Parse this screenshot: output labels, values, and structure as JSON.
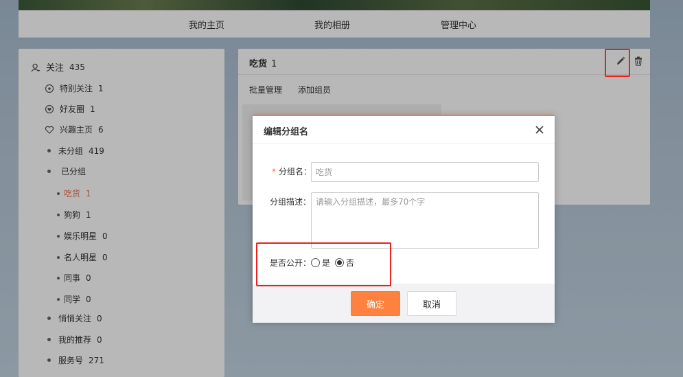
{
  "top_nav": {
    "items": [
      "我的主页",
      "我的相册",
      "管理中心"
    ]
  },
  "sidebar": {
    "header": {
      "label": "关注",
      "count": "435"
    },
    "items": [
      {
        "label": "特别关注",
        "count": "1",
        "icon": "eye-icon"
      },
      {
        "label": "好友圈",
        "count": "1",
        "icon": "heart-circle-icon"
      },
      {
        "label": "兴趣主页",
        "count": "6",
        "icon": "heart-outline-icon"
      },
      {
        "label": "未分组",
        "count": "419"
      },
      {
        "label": "已分组",
        "count": ""
      }
    ],
    "groups": [
      {
        "label": "吃货",
        "count": "1",
        "active": true
      },
      {
        "label": "狗狗",
        "count": "1"
      },
      {
        "label": "娱乐明星",
        "count": "0"
      },
      {
        "label": "名人明星",
        "count": "0"
      },
      {
        "label": "同事",
        "count": "0"
      },
      {
        "label": "同学",
        "count": "0"
      }
    ],
    "bottom_items": [
      {
        "label": "悄悄关注",
        "count": "0"
      },
      {
        "label": "我的推荐",
        "count": "0"
      },
      {
        "label": "服务号",
        "count": "271"
      }
    ]
  },
  "panel": {
    "title": "吃货",
    "count": "1",
    "tools": [
      "批量管理",
      "添加组员"
    ],
    "edit_icon": "pencil-icon",
    "delete_icon": "trash-icon"
  },
  "dialog": {
    "title": "编辑分组名",
    "name_label": "分组名：",
    "name_placeholder": "吃货",
    "desc_label": "分组描述：",
    "desc_placeholder": "请输入分组描述，最多70个字",
    "public_label": "是否公开：",
    "public_options": [
      {
        "label": "是",
        "checked": false
      },
      {
        "label": "否",
        "checked": true
      }
    ],
    "ok_label": "确定",
    "cancel_label": "取消"
  },
  "colors": {
    "accent": "#ff8140",
    "active_text": "#eb7350",
    "highlight": "#e8211c"
  }
}
